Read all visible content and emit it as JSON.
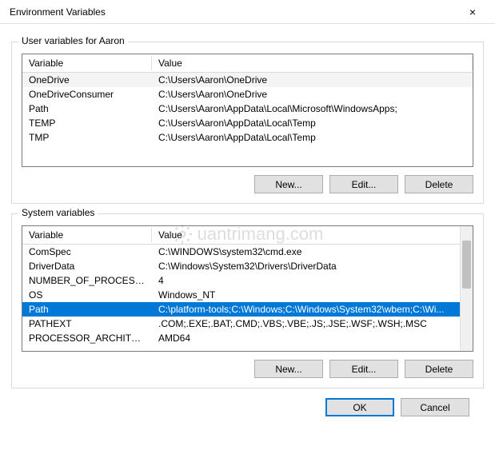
{
  "window": {
    "title": "Environment Variables",
    "close": "×"
  },
  "user_group": {
    "label": "User variables for Aaron",
    "col_var": "Variable",
    "col_val": "Value",
    "rows": [
      {
        "var": "OneDrive",
        "val": "C:\\Users\\Aaron\\OneDrive",
        "alt": true
      },
      {
        "var": "OneDriveConsumer",
        "val": "C:\\Users\\Aaron\\OneDrive"
      },
      {
        "var": "Path",
        "val": "C:\\Users\\Aaron\\AppData\\Local\\Microsoft\\WindowsApps;"
      },
      {
        "var": "TEMP",
        "val": "C:\\Users\\Aaron\\AppData\\Local\\Temp"
      },
      {
        "var": "TMP",
        "val": "C:\\Users\\Aaron\\AppData\\Local\\Temp"
      }
    ],
    "buttons": {
      "new": "New...",
      "edit": "Edit...",
      "delete": "Delete"
    }
  },
  "sys_group": {
    "label": "System variables",
    "col_var": "Variable",
    "col_val": "Value",
    "rows": [
      {
        "var": "ComSpec",
        "val": "C:\\WINDOWS\\system32\\cmd.exe"
      },
      {
        "var": "DriverData",
        "val": "C:\\Windows\\System32\\Drivers\\DriverData"
      },
      {
        "var": "NUMBER_OF_PROCESSORS",
        "val": "4"
      },
      {
        "var": "OS",
        "val": "Windows_NT"
      },
      {
        "var": "Path",
        "val": "C:\\platform-tools;C:\\Windows;C:\\Windows\\System32\\wbem;C:\\Wi...",
        "selected": true
      },
      {
        "var": "PATHEXT",
        "val": ".COM;.EXE;.BAT;.CMD;.VBS;.VBE;.JS;.JSE;.WSF;.WSH;.MSC"
      },
      {
        "var": "PROCESSOR_ARCHITECTURE",
        "val": "AMD64"
      }
    ],
    "buttons": {
      "new": "New...",
      "edit": "Edit...",
      "delete": "Delete"
    }
  },
  "footer": {
    "ok": "OK",
    "cancel": "Cancel"
  },
  "watermark": "uantrimang.com"
}
